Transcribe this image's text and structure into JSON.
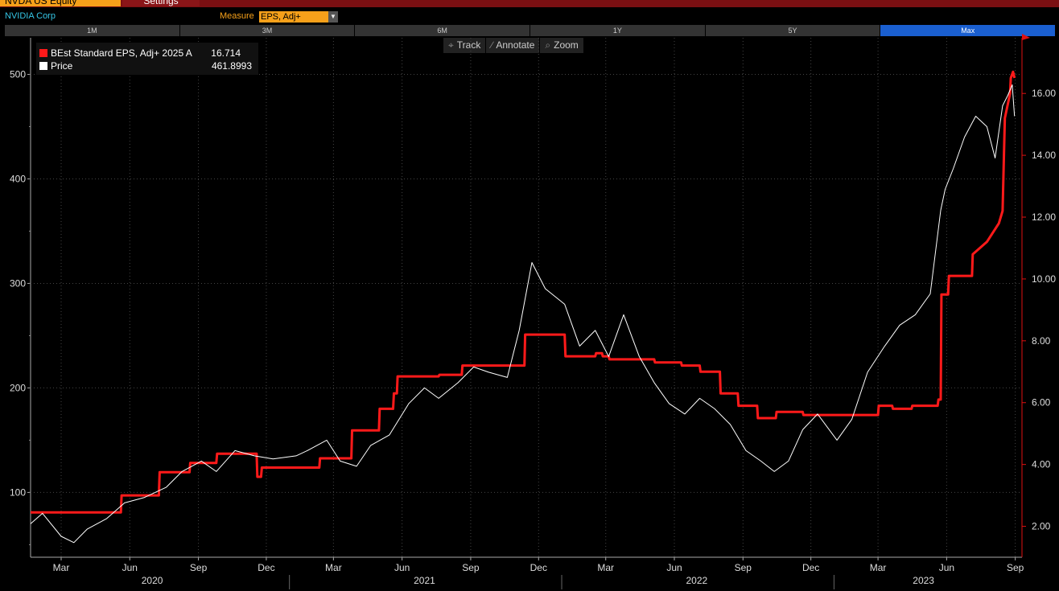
{
  "header": {
    "ticker_tab": "NVDA US Equity",
    "settings_tab": "Settings",
    "company": "NVIDIA Corp",
    "measure_label": "Measure",
    "measure_value": "EPS, Adj+",
    "dropdown_arrow": "▼"
  },
  "ranges": [
    "1M",
    "3M",
    "6M",
    "1Y",
    "5Y",
    "Max"
  ],
  "active_range": "Max",
  "toolbar": {
    "track": "Track",
    "annotate": "Annotate",
    "zoom": "Zoom",
    "track_icon": "crosshair-icon",
    "annotate_icon": "pencil-icon",
    "zoom_icon": "magnifier-icon"
  },
  "legend": {
    "eps_label": "BEst Standard EPS, Adj+ 2025 A",
    "eps_value": "16.714",
    "price_label": "Price",
    "price_value": "461.8993"
  },
  "colors": {
    "eps": "#ff1a1a",
    "price": "#ffffff",
    "accent": "#f6a01a",
    "active_range": "#1a5fd0"
  },
  "chart_data": {
    "type": "line",
    "x_months": [
      "Mar",
      "Jun",
      "Sep",
      "Dec",
      "Mar",
      "Jun",
      "Sep",
      "Dec",
      "Mar",
      "Jun",
      "Sep",
      "Dec",
      "Mar",
      "Jun",
      "Sep"
    ],
    "x_years": [
      "2020",
      "2021",
      "2022",
      "2023"
    ],
    "left_axis": {
      "ticks": [
        "100",
        "200",
        "300",
        "400",
        "500"
      ],
      "range": [
        38,
        535
      ]
    },
    "right_axis": {
      "ticks": [
        "2.00",
        "4.00",
        "6.00",
        "8.00",
        "10.00",
        "12.00",
        "14.00",
        "16.00"
      ],
      "range": [
        1.0,
        17.8
      ]
    },
    "series": [
      {
        "name": "BEst Standard EPS, Adj+ 2025 A",
        "axis": "right",
        "x": [
          "2020-01-20",
          "2020-05-20",
          "2020-05-21",
          "2020-07-10",
          "2020-07-11",
          "2020-08-20",
          "2020-08-21",
          "2020-09-25",
          "2020-09-26",
          "2020-11-18",
          "2020-11-19",
          "2020-11-24",
          "2020-11-25",
          "2021-02-10",
          "2021-02-11",
          "2021-03-25",
          "2021-03-26",
          "2021-05-01",
          "2021-05-02",
          "2021-05-20",
          "2021-05-21",
          "2021-05-25",
          "2021-05-26",
          "2021-06-15",
          "2021-06-16",
          "2021-07-20",
          "2021-07-21",
          "2021-08-20",
          "2021-08-21",
          "2021-11-12",
          "2021-11-13",
          "2022-01-05",
          "2022-01-06",
          "2022-02-15",
          "2022-02-16",
          "2022-02-24",
          "2022-02-25",
          "2022-03-05",
          "2022-03-06",
          "2022-05-05",
          "2022-05-06",
          "2022-06-10",
          "2022-06-11",
          "2022-07-05",
          "2022-07-06",
          "2022-08-01",
          "2022-08-02",
          "2022-08-25",
          "2022-08-26",
          "2022-09-20",
          "2022-09-21",
          "2022-10-15",
          "2022-10-16",
          "2022-11-20",
          "2022-11-21",
          "2023-03-01",
          "2023-03-02",
          "2023-03-20",
          "2023-03-21",
          "2023-04-15",
          "2023-04-16",
          "2023-05-20",
          "2023-05-21",
          "2023-05-24",
          "2023-05-25",
          "2023-06-03",
          "2023-06-04",
          "2023-07-05",
          "2023-07-06",
          "2023-07-25",
          "2023-08-10",
          "2023-08-15",
          "2023-08-18",
          "2023-08-25",
          "2023-08-26",
          "2023-08-29",
          "2023-08-31"
        ],
        "y": [
          2.45,
          2.45,
          3.0,
          3.0,
          3.75,
          3.75,
          4.05,
          4.05,
          4.35,
          4.35,
          3.6,
          3.6,
          3.9,
          3.9,
          4.2,
          4.2,
          5.1,
          5.1,
          5.8,
          5.8,
          6.3,
          6.3,
          6.85,
          6.85,
          6.85,
          6.85,
          6.9,
          6.9,
          7.2,
          7.2,
          8.2,
          8.2,
          7.5,
          7.5,
          7.6,
          7.6,
          7.5,
          7.5,
          7.4,
          7.4,
          7.3,
          7.3,
          7.2,
          7.2,
          7.0,
          7.0,
          6.3,
          6.3,
          5.9,
          5.9,
          5.5,
          5.5,
          5.7,
          5.7,
          5.6,
          5.6,
          5.9,
          5.9,
          5.8,
          5.8,
          5.9,
          5.9,
          6.1,
          6.1,
          9.5,
          9.5,
          10.1,
          10.1,
          10.8,
          11.2,
          11.8,
          12.2,
          15.2,
          16.0,
          16.5,
          16.7,
          16.5
        ]
      },
      {
        "name": "Price",
        "axis": "left",
        "x": [
          "2020-01-20",
          "2020-02-05",
          "2020-03-01",
          "2020-03-18",
          "2020-04-05",
          "2020-05-01",
          "2020-05-25",
          "2020-06-20",
          "2020-07-20",
          "2020-08-10",
          "2020-09-05",
          "2020-09-25",
          "2020-10-20",
          "2020-11-15",
          "2020-12-10",
          "2021-01-10",
          "2021-01-25",
          "2021-02-20",
          "2021-03-10",
          "2021-04-01",
          "2021-04-20",
          "2021-05-15",
          "2021-06-10",
          "2021-07-01",
          "2021-07-20",
          "2021-08-15",
          "2021-09-05",
          "2021-09-25",
          "2021-10-20",
          "2021-11-05",
          "2021-11-22",
          "2021-12-10",
          "2022-01-05",
          "2022-01-25",
          "2022-02-15",
          "2022-03-05",
          "2022-03-25",
          "2022-04-15",
          "2022-05-05",
          "2022-05-25",
          "2022-06-15",
          "2022-07-05",
          "2022-07-25",
          "2022-08-15",
          "2022-09-05",
          "2022-09-25",
          "2022-10-13",
          "2022-11-01",
          "2022-11-20",
          "2022-12-10",
          "2023-01-05",
          "2023-01-25",
          "2023-02-15",
          "2023-03-10",
          "2023-03-30",
          "2023-04-20",
          "2023-05-10",
          "2023-05-24",
          "2023-05-30",
          "2023-06-10",
          "2023-06-25",
          "2023-07-10",
          "2023-07-25",
          "2023-08-05",
          "2023-08-15",
          "2023-08-22",
          "2023-08-28",
          "2023-08-31"
        ],
        "y": [
          70,
          80,
          58,
          52,
          65,
          75,
          90,
          95,
          105,
          120,
          130,
          120,
          140,
          135,
          132,
          135,
          140,
          150,
          130,
          125,
          145,
          155,
          185,
          200,
          190,
          205,
          220,
          215,
          210,
          255,
          320,
          295,
          280,
          240,
          255,
          230,
          270,
          230,
          205,
          185,
          175,
          190,
          180,
          165,
          140,
          130,
          120,
          130,
          160,
          175,
          150,
          170,
          215,
          240,
          260,
          270,
          290,
          370,
          390,
          410,
          440,
          460,
          450,
          420,
          470,
          480,
          490,
          460
        ]
      }
    ]
  }
}
